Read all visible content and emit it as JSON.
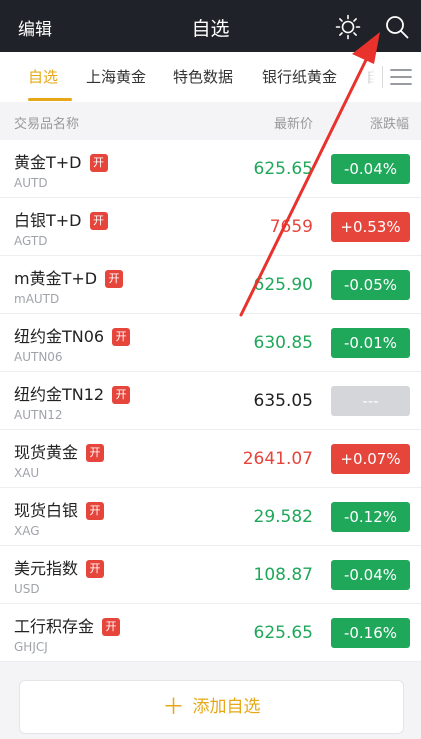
{
  "topbar": {
    "edit_label": "编辑",
    "title": "自选",
    "sun_icon": "brightness-icon",
    "search_icon": "search-icon"
  },
  "tabs": [
    {
      "label": "自选",
      "active": true
    },
    {
      "label": "上海黄金",
      "active": false
    },
    {
      "label": "特色数据",
      "active": false
    },
    {
      "label": "银行纸黄金",
      "active": false
    },
    {
      "label": "自",
      "active": false
    }
  ],
  "header": {
    "name": "交易品名称",
    "price": "最新价",
    "change": "涨跌幅"
  },
  "rows": [
    {
      "name": "黄金T+D",
      "badge": "开",
      "code": "AUTD",
      "price": "625.65",
      "change": "-0.04%",
      "trend": "down"
    },
    {
      "name": "白银T+D",
      "badge": "开",
      "code": "AGTD",
      "price": "7659",
      "change": "+0.53%",
      "trend": "up"
    },
    {
      "name": "m黄金T+D",
      "badge": "开",
      "code": "mAUTD",
      "price": "625.90",
      "change": "-0.05%",
      "trend": "down"
    },
    {
      "name": "纽约金TN06",
      "badge": "开",
      "code": "AUTN06",
      "price": "630.85",
      "change": "-0.01%",
      "trend": "down"
    },
    {
      "name": "纽约金TN12",
      "badge": "开",
      "code": "AUTN12",
      "price": "635.05",
      "change": "---",
      "trend": "flat"
    },
    {
      "name": "现货黄金",
      "badge": "开",
      "code": "XAU",
      "price": "2641.07",
      "change": "+0.07%",
      "trend": "up"
    },
    {
      "name": "现货白银",
      "badge": "开",
      "code": "XAG",
      "price": "29.582",
      "change": "-0.12%",
      "trend": "down"
    },
    {
      "name": "美元指数",
      "badge": "开",
      "code": "USD",
      "price": "108.87",
      "change": "-0.04%",
      "trend": "down"
    },
    {
      "name": "工行积存金",
      "badge": "开",
      "code": "GHJCJ",
      "price": "625.65",
      "change": "-0.16%",
      "trend": "down"
    }
  ],
  "add_button": {
    "label": "添加自选",
    "plus": "＋"
  },
  "colors": {
    "accent": "#e6a817",
    "up": "#e6453c",
    "down": "#1fa85a",
    "flat": "#d5d6d9",
    "topbar": "#1f2229"
  }
}
